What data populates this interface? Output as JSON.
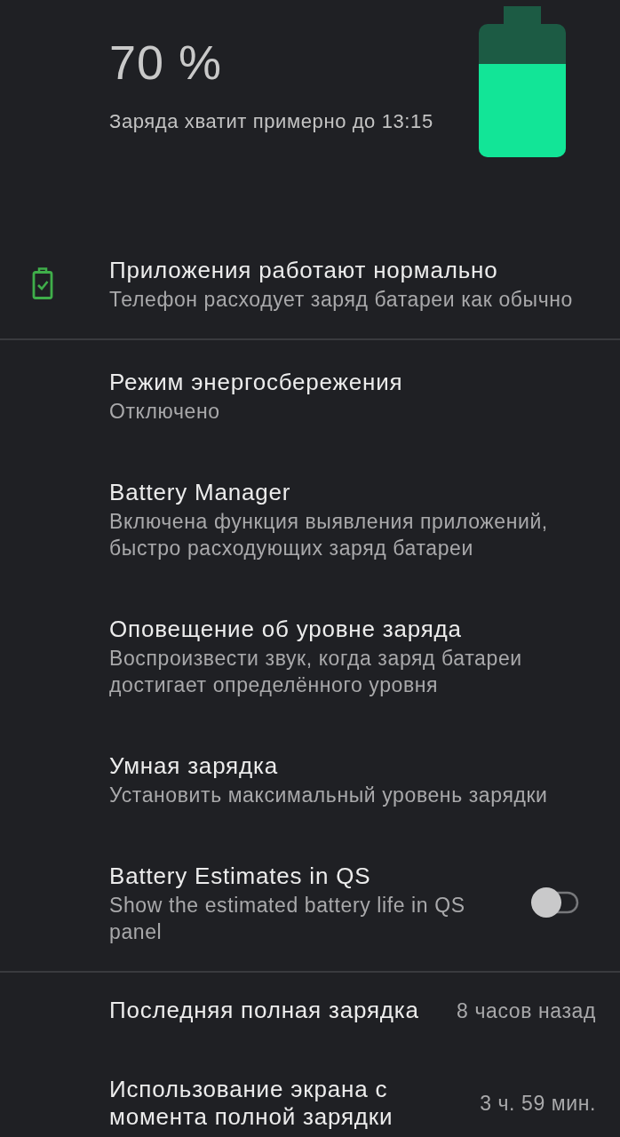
{
  "header": {
    "percent": "70 %",
    "estimate": "Заряда хватит примерно до 13:15",
    "battery": {
      "level": 0.7
    }
  },
  "status": {
    "title": "Приложения работают нормально",
    "subtitle": "Телефон расходует заряд батареи как обычно"
  },
  "settings": [
    {
      "kind": "link",
      "title": "Режим энергосбережения",
      "subtitle": "Отключено"
    },
    {
      "kind": "link",
      "title": "Battery Manager",
      "subtitle": "Включена функция выявления приложений, быстро расходующих заряд батареи"
    },
    {
      "kind": "link",
      "title": "Оповещение об уровне заряда",
      "subtitle": "Воспроизвести звук, когда заряд батареи достигает определённого уровня"
    },
    {
      "kind": "link",
      "title": "Умная зарядка",
      "subtitle": "Установить максимальный уровень зарядки"
    },
    {
      "kind": "switch",
      "title": "Battery Estimates in QS",
      "subtitle": "Show the estimated battery life in QS panel",
      "on": false
    }
  ],
  "usage": [
    {
      "title": "Последняя полная зарядка",
      "value": "8 часов назад"
    },
    {
      "title": "Использование экрана с момента полной зарядки",
      "value": "3 ч. 59 мин."
    }
  ]
}
